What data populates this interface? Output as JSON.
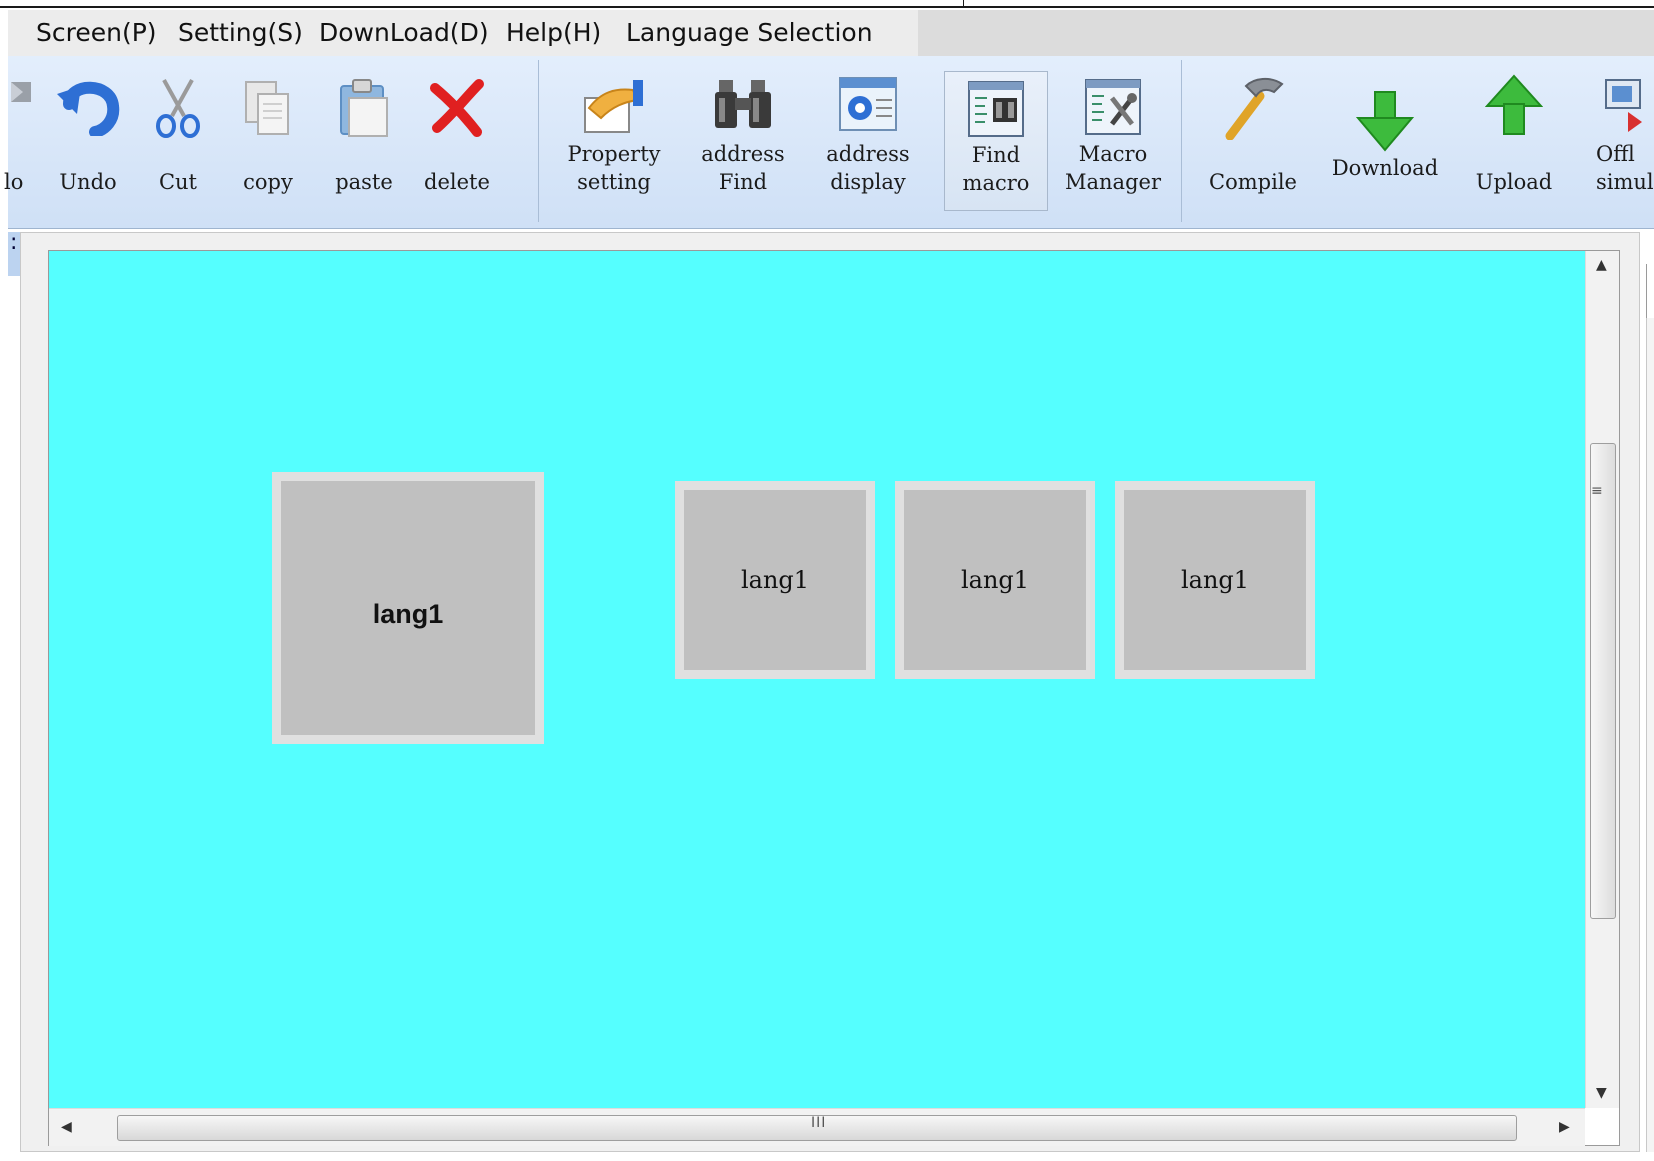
{
  "menu": {
    "items": [
      "Screen(P)",
      "Setting(S)",
      "DownLoad(D)",
      "Help(H)",
      "Language Selection"
    ]
  },
  "toolbar": {
    "buttons": [
      {
        "label": "lo",
        "icon": "redo-icon"
      },
      {
        "label": "Undo",
        "icon": "undo-icon"
      },
      {
        "label": "Cut",
        "icon": "scissors-icon"
      },
      {
        "label": "copy",
        "icon": "copy-icon"
      },
      {
        "label": "paste",
        "icon": "paste-icon"
      },
      {
        "label": "delete",
        "icon": "delete-x-icon"
      },
      {
        "label": "Property\nsetting",
        "icon": "property-card-icon"
      },
      {
        "label": "address\nFind",
        "icon": "binoculars-icon"
      },
      {
        "label": "address\ndisplay",
        "icon": "address-window-icon"
      },
      {
        "label": "Find\nmacro",
        "icon": "find-macro-icon",
        "selected": true
      },
      {
        "label": "Macro\nManager",
        "icon": "macro-manager-icon"
      },
      {
        "label": "Compile",
        "icon": "hammer-icon"
      },
      {
        "label": "Download",
        "icon": "down-arrow-icon"
      },
      {
        "label": "Upload",
        "icon": "up-arrow-icon"
      },
      {
        "label": "Offl\nsimul",
        "icon": "offline-sim-icon"
      }
    ]
  },
  "canvas": {
    "background": "#55ffff",
    "boxes": [
      {
        "label": "lang1",
        "style": "big"
      },
      {
        "label": "lang1",
        "style": "small"
      },
      {
        "label": "lang1",
        "style": "small"
      },
      {
        "label": "lang1",
        "style": "small"
      }
    ]
  },
  "colors": {
    "toolbar_bg": "#d6e5f8",
    "canvas_bg": "#55ffff",
    "box_fill": "#c0c0c0",
    "box_border": "#e0e0e0"
  }
}
